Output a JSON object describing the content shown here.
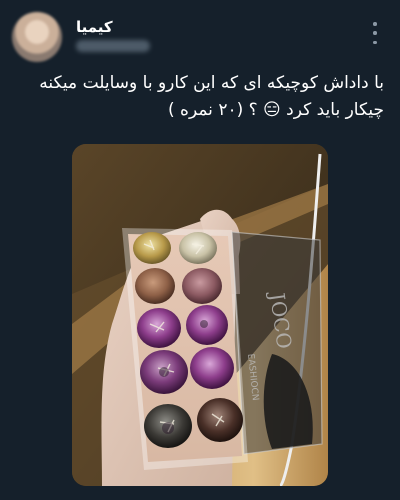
{
  "tweet": {
    "author_name": "کیمیا",
    "handle_blurred": true,
    "text_lines": [
      "با داداش کوچیکه ای که این کارو با وسایلت میکنه",
      "چیکار باید کرد 😑 ؟ (۲۰ نمره )"
    ],
    "more_icon": "more-vertical-icon"
  },
  "media": {
    "description_icon": "photo",
    "palette_brand_top": "JOCO",
    "palette_brand_side": "EASHIOCN"
  },
  "colors": {
    "background": "#15202b",
    "text": "#ffffff",
    "muted": "#8b98a5"
  }
}
